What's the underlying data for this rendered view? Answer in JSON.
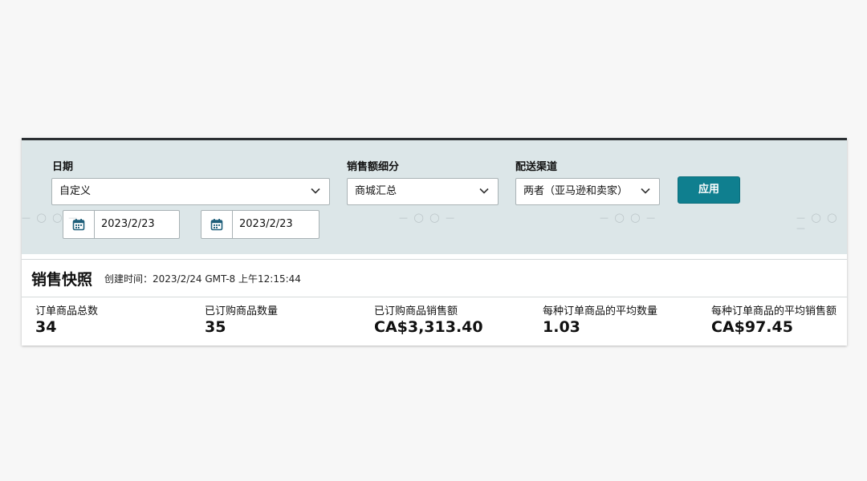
{
  "filters": {
    "date": {
      "label": "日期",
      "selected": "自定义",
      "start_date": "2023/2/23",
      "end_date": "2023/2/23"
    },
    "sales_breakdown": {
      "label": "销售额细分",
      "selected": "商城汇总"
    },
    "fulfillment_channel": {
      "label": "配送渠道",
      "selected": "两者（亚马逊和卖家）"
    },
    "apply_label": "应用"
  },
  "snapshot": {
    "title": "销售快照",
    "created_time": "创建时间：2023/2/24 GMT-8 上午12:15:44",
    "metrics": [
      {
        "label": "订单商品总数",
        "value": "34"
      },
      {
        "label": "已订购商品数量",
        "value": "35"
      },
      {
        "label": "已订购商品销售额",
        "value": "CA$3,313.40"
      },
      {
        "label": "每种订单商品的平均数量",
        "value": "1.03"
      },
      {
        "label": "每种订单商品的平均销售额",
        "value": "CA$97.45"
      }
    ]
  },
  "icons": {
    "calendar": "calendar-icon",
    "dropdown": "chevron-down-icon"
  },
  "colors": {
    "apply_button": "#0f7f8f",
    "filter_background": "#dce6e8",
    "calendar_icon": "#1f5f7a"
  }
}
